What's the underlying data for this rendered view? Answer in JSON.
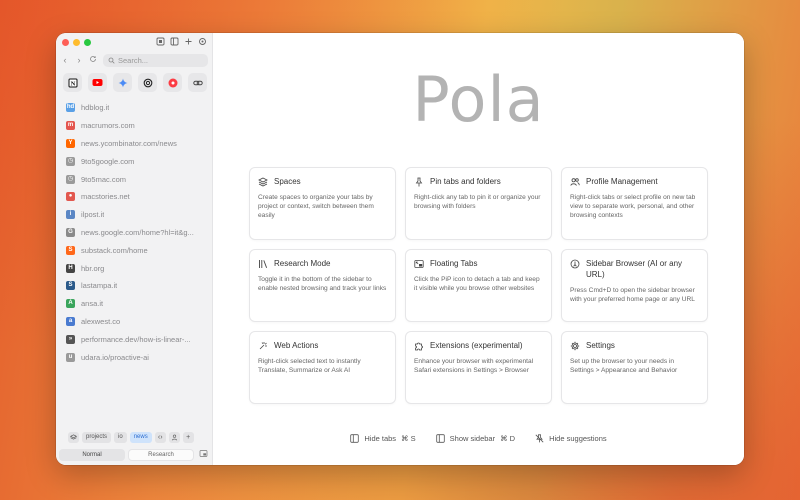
{
  "sidebar": {
    "search_placeholder": "Search...",
    "pinned": [
      {
        "icon": "notion-icon",
        "color": "#111111"
      },
      {
        "icon": "youtube-icon",
        "color": "#ff0000"
      },
      {
        "icon": "gemini-icon",
        "color": "#4285f4"
      },
      {
        "icon": "chatgpt-icon",
        "color": "#222222"
      },
      {
        "icon": "music-icon",
        "color": "#fc3c44"
      },
      {
        "icon": "link-icon",
        "color": "#444444"
      }
    ],
    "tabs": [
      {
        "label": "hdblog.it",
        "color": "#5aa0e6",
        "glyph": "hd"
      },
      {
        "label": "macrumors.com",
        "color": "#e4564f",
        "glyph": "m"
      },
      {
        "label": "news.ycombinator.com/news",
        "color": "#ff6600",
        "glyph": "Y"
      },
      {
        "label": "9to5google.com",
        "color": "#9a9a9a",
        "glyph": "◷"
      },
      {
        "label": "9to5mac.com",
        "color": "#9a9a9a",
        "glyph": "◷"
      },
      {
        "label": "macstories.net",
        "color": "#e2584f",
        "glyph": "●"
      },
      {
        "label": "ilpost.it",
        "color": "#5b87c5",
        "glyph": "i"
      },
      {
        "label": "news.google.com/home?hl=it&g...",
        "color": "#8a8a8a",
        "glyph": "G"
      },
      {
        "label": "substack.com/home",
        "color": "#ff6719",
        "glyph": "S"
      },
      {
        "label": "hbr.org",
        "color": "#444444",
        "glyph": "H"
      },
      {
        "label": "lastampa.it",
        "color": "#2b5a8a",
        "glyph": "S"
      },
      {
        "label": "ansa.it",
        "color": "#3aa55c",
        "glyph": "A"
      },
      {
        "label": "alexwest.co",
        "color": "#4a7bd0",
        "glyph": "a"
      },
      {
        "label": "performance.dev/how-is-linear-...",
        "color": "#555555",
        "glyph": "»"
      },
      {
        "label": "udara.io/proactive-ai",
        "color": "#9a9a9a",
        "glyph": "u"
      }
    ],
    "spaces": {
      "projects": "projects",
      "io": "io",
      "news": "news"
    },
    "profiles": {
      "normal": "Normal",
      "research": "Research"
    }
  },
  "main": {
    "logo": "Pola",
    "cards": [
      {
        "title": "Spaces",
        "icon": "layers-icon",
        "desc": "Create spaces to organize your tabs by project or context, switch between them easily"
      },
      {
        "title": "Pin tabs and folders",
        "icon": "pin-icon",
        "desc": "Right-click any tab to pin it or organize your browsing with folders"
      },
      {
        "title": "Profile Management",
        "icon": "users-icon",
        "desc": "Right-click tabs or select profile on new tab view to separate work, personal, and other browsing contexts"
      },
      {
        "title": "Research Mode",
        "icon": "library-icon",
        "desc": "Toggle it in the bottom of the sidebar to enable nested browsing and track your links"
      },
      {
        "title": "Floating Tabs",
        "icon": "picture-in-picture-icon",
        "desc": "Click the PiP icon to detach a tab and keep it visible while you browse other websites"
      },
      {
        "title": "Sidebar Browser (AI or any URL)",
        "icon": "globe-icon",
        "desc": "Press Cmd+D to open the sidebar browser with your preferred home page or any URL"
      },
      {
        "title": "Web Actions",
        "icon": "sparkle-icon",
        "desc": "Right-click selected text to instantly Translate, Summarize or Ask AI"
      },
      {
        "title": "Extensions (experimental)",
        "icon": "puzzle-icon",
        "desc": "Enhance your browser with experimental Safari extensions in Settings > Browser"
      },
      {
        "title": "Settings",
        "icon": "gear-icon",
        "desc": "Set up the browser to your needs in Settings > Appearance and Behavior"
      }
    ],
    "footer": {
      "hide_tabs": "Hide tabs",
      "hide_tabs_shortcut": "⌘ S",
      "show_sidebar": "Show sidebar",
      "show_sidebar_shortcut": "⌘ D",
      "hide_suggestions": "Hide suggestions"
    }
  }
}
